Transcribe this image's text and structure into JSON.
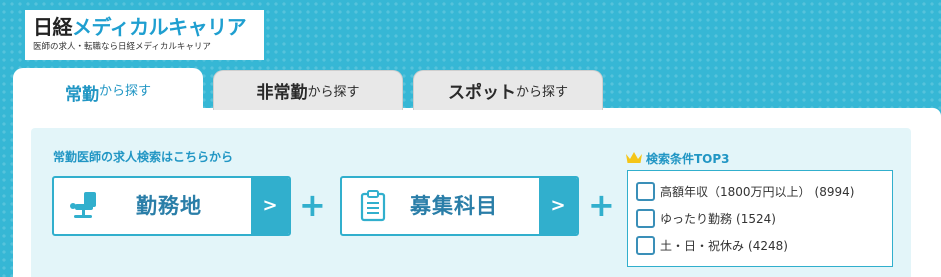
{
  "logo": {
    "brand_nikkei": "日経",
    "brand_medical": "メディカルキャリア",
    "tagline": "医師の求人・転職なら日経メディカルキャリア"
  },
  "tabs": [
    {
      "strong": "常勤",
      "rest": "から探す",
      "active": true
    },
    {
      "strong": "非常勤",
      "rest": "から探す",
      "active": false
    },
    {
      "strong": "スポット",
      "rest": "から探す",
      "active": false
    }
  ],
  "search": {
    "title": "常勤医師の求人検索はこちらから",
    "location_label": "勤務地",
    "specialty_label": "募集科目",
    "arrow": ">",
    "plus": "+"
  },
  "top3": {
    "title": "検索条件TOP3",
    "items": [
      {
        "label": "高額年収（1800万円以上）",
        "count": "(8994)"
      },
      {
        "label": "ゆったり勤務",
        "count": "(1524)"
      },
      {
        "label": "土・日・祝休み",
        "count": "(4248)"
      }
    ]
  },
  "colors": {
    "accent": "#31afcd",
    "accent_text": "#2196c4",
    "crown": "#f5c518"
  },
  "icons": {
    "location": "office-chair-icon",
    "specialty": "clipboard-icon",
    "top3": "crown-icon"
  }
}
